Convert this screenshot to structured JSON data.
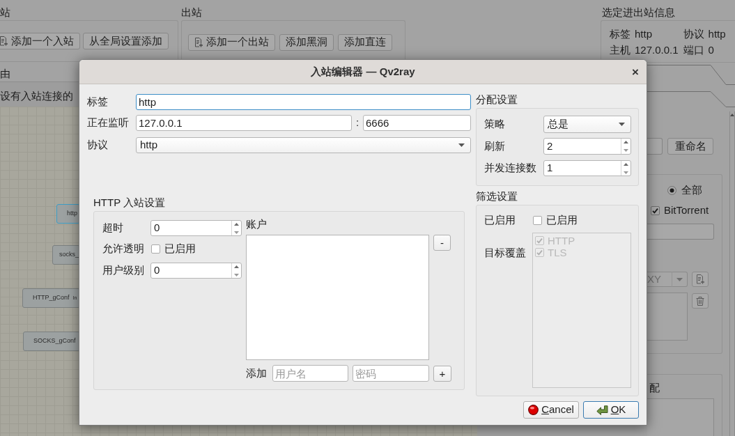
{
  "main_window": {
    "inbound": {
      "title": "站",
      "buttons": [
        {
          "kind": "icon",
          "label": "添加一个入站"
        },
        {
          "kind": "text",
          "label": "从全局设置添加"
        }
      ]
    },
    "outbound": {
      "title": "出站",
      "buttons": [
        {
          "kind": "icon",
          "label": "添加一个出站"
        },
        {
          "kind": "text",
          "label": "添加黑洞"
        },
        {
          "kind": "text",
          "label": "添加直连"
        }
      ]
    },
    "selected_info": {
      "title": "选定进出站信息",
      "fields": [
        {
          "label": "标签",
          "value": "http"
        },
        {
          "label": "协议",
          "value": "http"
        },
        {
          "label": "主机",
          "value": "127.0.0.1"
        },
        {
          "label": "端口",
          "value": "0"
        }
      ]
    },
    "routing": {
      "title": "由",
      "hint": "设有入站连接的",
      "nodes": [
        {
          "label": "http",
          "selected": true
        },
        {
          "label": "socks_",
          "selected": false
        },
        {
          "label": "HTTP_gConf",
          "tag": "In",
          "selected": false
        },
        {
          "label": "SOCKS_gConf",
          "selected": false
        }
      ]
    },
    "side_panel": {
      "rename_button": "重命名",
      "radio": {
        "label": "全部",
        "selected": true
      },
      "checkbox": {
        "label": "BitTorrent",
        "checked": true
      },
      "dropdown": {
        "value": "XY"
      },
      "section_title": "配"
    }
  },
  "dialog": {
    "title": "入站编辑器 — Qv2ray",
    "close": "×",
    "general": {
      "tag": {
        "label": "标签",
        "value": "http",
        "focused": true
      },
      "listen": {
        "label": "正在监听",
        "address": "127.0.0.1",
        "separator": ":",
        "port": "6666"
      },
      "protocol": {
        "label": "协议",
        "value": "http"
      }
    },
    "http_settings": {
      "title": "HTTP 入站设置",
      "timeout": {
        "label": "超时",
        "value": "0"
      },
      "transparent": {
        "label": "允许透明",
        "option": "已启用",
        "checked": false
      },
      "user_level": {
        "label": "用户级别",
        "value": "0"
      },
      "accounts": {
        "title": "账户",
        "remove_button": "-",
        "add_label": "添加",
        "username_placeholder": "用户名",
        "password_placeholder": "密码",
        "add_button": "+"
      }
    },
    "allocation": {
      "title": "分配设置",
      "strategy": {
        "label": "策略",
        "value": "总是"
      },
      "refresh": {
        "label": "刷新",
        "value": "2"
      },
      "concurrency": {
        "label": "并发连接数",
        "value": "1"
      }
    },
    "sniffing": {
      "title": "筛选设置",
      "enabled": {
        "label": "已启用",
        "option": "已启用",
        "checked": false
      },
      "dest_override": {
        "label": "目标覆盖",
        "items": [
          {
            "label": "HTTP",
            "checked": true,
            "disabled": true
          },
          {
            "label": "TLS",
            "checked": true,
            "disabled": true
          }
        ]
      }
    },
    "buttons": [
      {
        "kind": "cancel",
        "label": "Cancel",
        "default": false
      },
      {
        "kind": "ok",
        "label": "OK",
        "default": true
      }
    ]
  }
}
